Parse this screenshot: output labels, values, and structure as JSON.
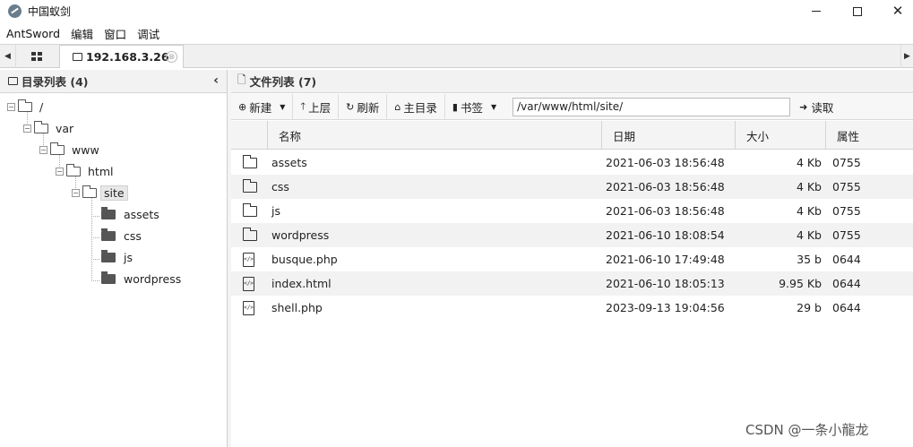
{
  "window": {
    "title": "中国蚁剑",
    "min_icon": "minimize-icon",
    "max_icon": "maximize-icon",
    "close_icon": "close-icon"
  },
  "menu": [
    "AntSword",
    "编辑",
    "窗口",
    "调试"
  ],
  "tabs": {
    "home_icon": "grid-icon",
    "host_label": "192.168.3.26",
    "close_glyph": "⊗"
  },
  "left_panel": {
    "title": "目录列表 (4)",
    "collapse_glyph": "‹",
    "tree": [
      {
        "label": "/",
        "level": 0,
        "expanded": true
      },
      {
        "label": "var",
        "level": 1,
        "expanded": true
      },
      {
        "label": "www",
        "level": 2,
        "expanded": true
      },
      {
        "label": "html",
        "level": 3,
        "expanded": true
      },
      {
        "label": "site",
        "level": 4,
        "expanded": true,
        "selected": true
      },
      {
        "label": "assets",
        "level": 5
      },
      {
        "label": "css",
        "level": 5
      },
      {
        "label": "js",
        "level": 5
      },
      {
        "label": "wordpress",
        "level": 5
      }
    ]
  },
  "right_panel": {
    "title": "文件列表 (7)",
    "toolbar": {
      "new_label": "新建",
      "up_label": "上层",
      "refresh_label": "刷新",
      "home_label": "主目录",
      "bookmark_label": "书签",
      "path_value": "/var/www/html/site/",
      "read_label": "读取"
    },
    "columns": {
      "name": "名称",
      "date": "日期",
      "size": "大小",
      "attr": "属性"
    },
    "files": [
      {
        "type": "folder",
        "name": "assets",
        "date": "2021-06-03 18:56:48",
        "size": "4 Kb",
        "attr": "0755"
      },
      {
        "type": "folder",
        "name": "css",
        "date": "2021-06-03 18:56:48",
        "size": "4 Kb",
        "attr": "0755"
      },
      {
        "type": "folder",
        "name": "js",
        "date": "2021-06-03 18:56:48",
        "size": "4 Kb",
        "attr": "0755"
      },
      {
        "type": "folder",
        "name": "wordpress",
        "date": "2021-06-10 18:08:54",
        "size": "4 Kb",
        "attr": "0755"
      },
      {
        "type": "file",
        "name": "busque.php",
        "date": "2021-06-10 17:49:48",
        "size": "35 b",
        "attr": "0644"
      },
      {
        "type": "file",
        "name": "index.html",
        "date": "2021-06-10 18:05:13",
        "size": "9.95 Kb",
        "attr": "0644"
      },
      {
        "type": "file",
        "name": "shell.php",
        "date": "2023-09-13 19:04:56",
        "size": "29 b",
        "attr": "0644"
      }
    ]
  },
  "watermark": "CSDN @一条小龍龙"
}
